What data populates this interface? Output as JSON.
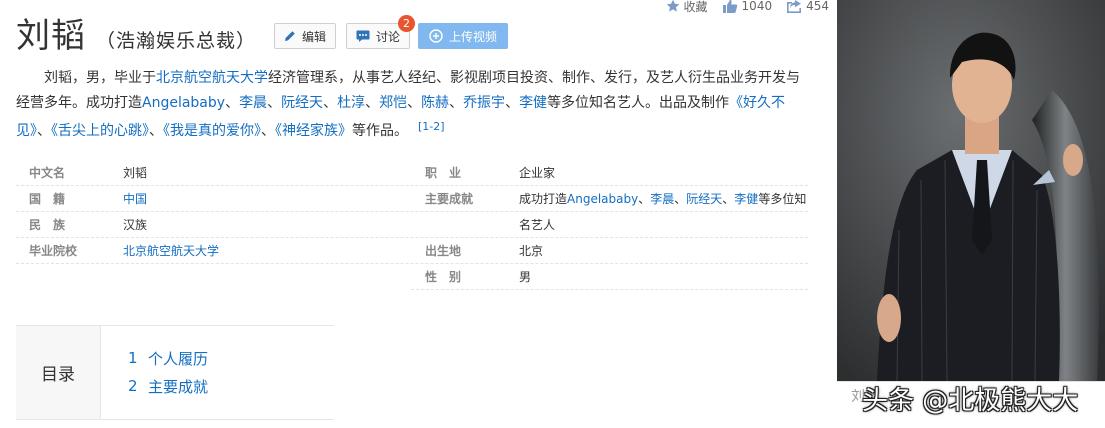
{
  "stats": {
    "favorite_label": "收藏",
    "like_count": "1040",
    "share_count": "454"
  },
  "title": "刘韬",
  "subtitle": "（浩瀚娱乐总裁）",
  "buttons": {
    "edit": "编辑",
    "discuss": "讨论",
    "discuss_badge": "2",
    "upload_video": "上传视频"
  },
  "summary": {
    "t1": "刘韬，男，毕业于",
    "l1": "北京航空航天大学",
    "t2": "经济管理系，从事艺人经纪、影视剧项目投资、制作、发行，及艺人衍生品业务开发与经营多年。成功打造",
    "l2": "Angelababy",
    "s1": "、",
    "l3": "李晨",
    "s2": "、",
    "l4": "阮经天",
    "s3": "、",
    "l5": "杜淳",
    "s4": "、",
    "l6": "郑恺",
    "s5": "、",
    "l7": "陈赫",
    "s6": "、",
    "l8": "乔振宇",
    "s7": "、",
    "l9": "李健",
    "t3": "等多位知名艺人。出品及制作",
    "l10": "《好久不见》",
    "s8": "、",
    "l11": "《舌尖上的心跳》",
    "s9": "、",
    "l12": "《我是真的爱你》",
    "s10": "、",
    "l13": "《神经家族》",
    "t4": "等作品。",
    "ref": "[1-2]"
  },
  "info": {
    "chinese_name_key": "中文名",
    "chinese_name_val": "刘韬",
    "occupation_key": "职　业",
    "occupation_val": "企业家",
    "nationality_key": "国　籍",
    "nationality_val": "中国",
    "achievement_key": "主要成就",
    "achievement_pre": "成功打造",
    "ach_l1": "Angelababy",
    "ach_s1": "、",
    "ach_l2": "李晨",
    "ach_s2": "、",
    "ach_l3": "阮经天",
    "ach_s3": "、",
    "ach_l4": "李健",
    "achievement_post": "等多位知",
    "ethnicity_key": "民　族",
    "ethnicity_val": "汉族",
    "achievement_cont": "名艺人",
    "school_key": "毕业院校",
    "school_val": "北京航空航天大学",
    "birthplace_key": "出生地",
    "birthplace_val": "北京",
    "gender_key": "性　别",
    "gender_val": "男"
  },
  "catalog": {
    "heading": "目录",
    "items": [
      {
        "num": "1",
        "title": "个人履历"
      },
      {
        "num": "2",
        "title": "主要成就"
      }
    ]
  },
  "photo_caption": "刘韬",
  "watermark": "头条 @北极熊大大",
  "colors": {
    "link": "#136ec2",
    "upload_button": "#80b8ef",
    "badge": "#e8542e"
  },
  "icons": [
    "star-icon",
    "thumbs-up-icon",
    "share-icon",
    "pencil-icon",
    "comment-icon",
    "upload-plus-icon"
  ]
}
